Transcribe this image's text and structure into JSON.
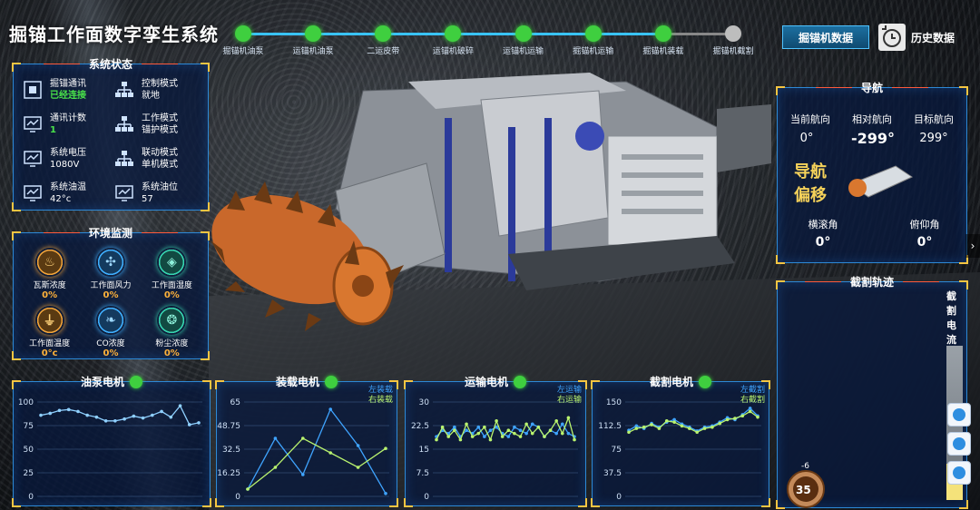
{
  "app": {
    "title": "掘锚工作面数字孪生系统"
  },
  "stepper": {
    "steps": [
      {
        "label": "掘锚机油泵",
        "state": "done"
      },
      {
        "label": "运锚机油泵",
        "state": "done"
      },
      {
        "label": "二运皮带",
        "state": "done"
      },
      {
        "label": "运锚机破碎",
        "state": "done"
      },
      {
        "label": "运锚机运输",
        "state": "done"
      },
      {
        "label": "掘锚机运输",
        "state": "done"
      },
      {
        "label": "掘锚机装载",
        "state": "done"
      },
      {
        "label": "掘锚机截割",
        "state": "todo"
      }
    ]
  },
  "header": {
    "data_button": "掘锚机数据",
    "history_button": "历史数据"
  },
  "status_panel": {
    "title": "系统状态",
    "items": [
      {
        "icon": "network-icon",
        "key": "掘锚通讯",
        "value": "已经连接",
        "highlight": true
      },
      {
        "icon": "hierarchy-icon",
        "key": "控制模式",
        "value": "就地",
        "highlight": false
      },
      {
        "icon": "monitor-icon",
        "key": "通讯计数",
        "value": "1",
        "highlight": true
      },
      {
        "icon": "hierarchy-icon",
        "key": "工作模式",
        "value": "锚护模式",
        "highlight": false
      },
      {
        "icon": "monitor-icon",
        "key": "系统电压",
        "value": "1080V",
        "highlight": false
      },
      {
        "icon": "hierarchy-icon",
        "key": "联动模式",
        "value": "单机模式",
        "highlight": false
      },
      {
        "icon": "monitor-icon",
        "key": "系统油温",
        "value": "42°c",
        "highlight": false
      },
      {
        "icon": "monitor-icon",
        "key": "系统油位",
        "value": "57",
        "highlight": false
      }
    ]
  },
  "env_panel": {
    "title": "环境监测",
    "items": [
      {
        "name": "瓦斯浓度",
        "value": "0%",
        "color": "orange",
        "glyph": "♨"
      },
      {
        "name": "工作面风力",
        "value": "0%",
        "color": "blue",
        "glyph": "✣"
      },
      {
        "name": "工作面湿度",
        "value": "0%",
        "color": "teal",
        "glyph": "◈"
      },
      {
        "name": "工作面温度",
        "value": "0°c",
        "color": "orange",
        "glyph": "⏚"
      },
      {
        "name": "CO浓度",
        "value": "0%",
        "color": "blue",
        "glyph": "❧"
      },
      {
        "name": "粉尘浓度",
        "value": "0%",
        "color": "teal",
        "glyph": "❂"
      }
    ]
  },
  "nav_panel": {
    "title": "导航",
    "current_heading_label": "当前航向",
    "relative_heading_label": "相对航向",
    "target_heading_label": "目标航向",
    "current_heading": "0°",
    "relative_heading": "-299°",
    "target_heading": "299°",
    "offset_label_1": "导航",
    "offset_label_2": "偏移",
    "roll_label": "横滚角",
    "pitch_label": "俯仰角",
    "roll": "0°",
    "pitch": "0°"
  },
  "cut_panel": {
    "title": "截割轨迹",
    "current_label": "截割电流",
    "gauge_value": "35",
    "gauge_mark": "-6"
  },
  "charts": {
    "pump": {
      "title": "油泵电机",
      "chart_data": {
        "type": "line",
        "ylim": [
          0,
          100
        ],
        "yticks": [
          "100",
          "75",
          "50",
          "25",
          "0"
        ],
        "series": [
          {
            "name": "",
            "color": "#8fd0ff",
            "values": [
              86,
              88,
              91,
              92,
              90,
              86,
              84,
              80,
              80,
              82,
              85,
              83,
              86,
              90,
              84,
              96,
              76,
              78
            ]
          }
        ]
      }
    },
    "loader": {
      "title": "装载电机",
      "legend": [
        "左装载",
        "右装载"
      ],
      "chart_data": {
        "type": "line",
        "ylim": [
          0,
          65
        ],
        "yticks": [
          "65",
          "48.75",
          "32.5",
          "16.25",
          "0"
        ],
        "series": [
          {
            "name": "左装载",
            "color": "#3fa4ff",
            "values": [
              5,
              40,
              15,
              60,
              35,
              2
            ]
          },
          {
            "name": "右装载",
            "color": "#b9f36e",
            "values": [
              5,
              20,
              40,
              30,
              20,
              33
            ]
          }
        ]
      }
    },
    "transport": {
      "title": "运输电机",
      "legend": [
        "左运输",
        "右运输"
      ],
      "chart_data": {
        "type": "line",
        "ylim": [
          0,
          30
        ],
        "yticks": [
          "30",
          "22.5",
          "15",
          "7.5",
          "0"
        ],
        "series": [
          {
            "name": "左运输",
            "color": "#3fa4ff",
            "values": [
              19,
              21,
              20,
              22,
              19,
              21,
              20,
              22,
              19,
              21,
              22,
              20,
              19,
              22,
              21,
              20,
              23,
              22,
              19,
              21,
              20,
              23,
              20,
              19
            ]
          },
          {
            "name": "右运输",
            "color": "#b9f36e",
            "values": [
              18,
              22,
              19,
              21,
              18,
              23,
              19,
              20,
              22,
              18,
              24,
              19,
              21,
              20,
              19,
              23,
              20,
              22,
              19,
              21,
              24,
              20,
              25,
              18
            ]
          }
        ]
      }
    },
    "cutter": {
      "title": "截割电机",
      "legend": [
        "左截割",
        "右截割"
      ],
      "chart_data": {
        "type": "line",
        "ylim": [
          0,
          150
        ],
        "yticks": [
          "150",
          "112.5",
          "75",
          "37.5",
          "0"
        ],
        "series": [
          {
            "name": "左截割",
            "color": "#3fa4ff",
            "values": [
              105,
              112,
              108,
              116,
              110,
              118,
              122,
              115,
              110,
              104,
              110,
              112,
              118,
              125,
              122,
              130,
              140,
              128
            ]
          },
          {
            "name": "右截割",
            "color": "#b9f36e",
            "values": [
              102,
              108,
              110,
              114,
              108,
              120,
              118,
              112,
              108,
              102,
              108,
              110,
              116,
              122,
              124,
              128,
              135,
              126
            ]
          }
        ]
      }
    }
  }
}
